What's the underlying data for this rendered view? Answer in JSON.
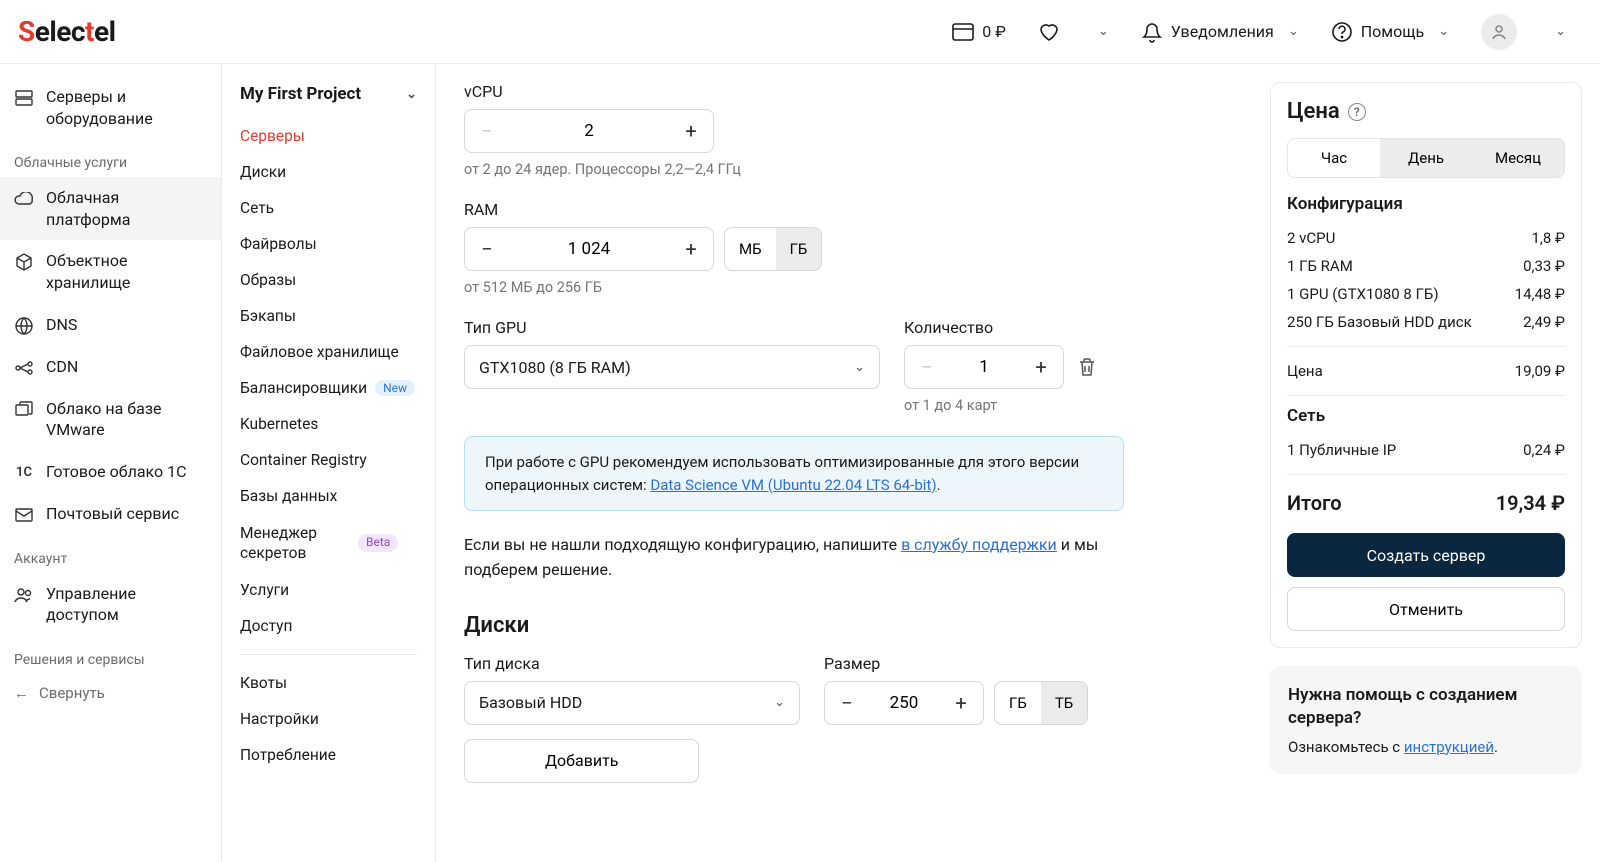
{
  "topbar": {
    "balance": "0 ₽",
    "notifications": "Уведомления",
    "help": "Помощь"
  },
  "sidebar1": {
    "items": [
      {
        "label": "Серверы и оборудование"
      }
    ],
    "section_cloud": "Облачные услуги",
    "cloud_items": [
      {
        "label": "Облачная платформа"
      },
      {
        "label": "Объектное хранилище"
      },
      {
        "label": "DNS"
      },
      {
        "label": "CDN"
      },
      {
        "label": "Облако на базе VMware"
      },
      {
        "label": "Готовое облако 1С"
      },
      {
        "label": "Почтовый сервис"
      }
    ],
    "section_account": "Аккаунт",
    "account_items": [
      {
        "label": "Управление доступом"
      }
    ],
    "section_solutions": "Решения и сервисы",
    "collapse": "Свернуть"
  },
  "sidebar2": {
    "project": "My First Project",
    "items": [
      {
        "label": "Серверы"
      },
      {
        "label": "Диски"
      },
      {
        "label": "Сеть"
      },
      {
        "label": "Файрволы"
      },
      {
        "label": "Образы"
      },
      {
        "label": "Бэкапы"
      },
      {
        "label": "Файловое хранилище"
      },
      {
        "label": "Балансировщики",
        "badge": "New"
      },
      {
        "label": "Kubernetes"
      },
      {
        "label": "Container Registry"
      },
      {
        "label": "Базы данных"
      },
      {
        "label": "Менеджер секретов",
        "badge": "Beta"
      },
      {
        "label": "Услуги"
      },
      {
        "label": "Доступ"
      }
    ],
    "bottom": [
      {
        "label": "Квоты"
      },
      {
        "label": "Настройки"
      },
      {
        "label": "Потребление"
      }
    ]
  },
  "main": {
    "vcpu": {
      "label": "vCPU",
      "value": "2",
      "hint": "от 2 до 24 ядер. Процессоры 2,2—2,4 ГГц"
    },
    "ram": {
      "label": "RAM",
      "value": "1 024",
      "unit_mb": "МБ",
      "unit_gb": "ГБ",
      "hint": "от 512 МБ до 256 ГБ"
    },
    "gpu_type": {
      "label": "Тип GPU",
      "value": "GTX1080 (8 ГБ RAM)"
    },
    "gpu_qty": {
      "label": "Количество",
      "value": "1",
      "hint": "от 1 до 4 карт"
    },
    "info": {
      "text1": "При работе с GPU рекомендуем использовать оптимизированные для этого версии операционных систем: ",
      "link": "Data Science VM (Ubuntu 22.04 LTS 64-bit)"
    },
    "support": {
      "text1": "Если вы не нашли подходящую конфигурацию, напишите ",
      "link": "в службу поддержки",
      "text2": " и мы подберем решение."
    },
    "disks": {
      "heading": "Диски",
      "type_label": "Тип диска",
      "type_value": "Базовый HDD",
      "size_label": "Размер",
      "size_value": "250",
      "unit_gb": "ГБ",
      "unit_tb": "ТБ",
      "add": "Добавить"
    }
  },
  "price": {
    "title": "Цена",
    "tabs": {
      "hour": "Час",
      "day": "День",
      "month": "Месяц"
    },
    "config_h": "Конфигурация",
    "lines": [
      {
        "l": "2 vCPU",
        "r": "1,8 ₽"
      },
      {
        "l": "1 ГБ RAM",
        "r": "0,33 ₽"
      },
      {
        "l": "1 GPU (GTX1080 8 ГБ)",
        "r": "14,48 ₽"
      },
      {
        "l": "250 ГБ Базовый HDD диск",
        "r": "2,49 ₽"
      }
    ],
    "subtotal": {
      "l": "Цена",
      "r": "19,09 ₽"
    },
    "net_h": "Сеть",
    "net": {
      "l": "1 Публичные IP",
      "r": "0,24 ₽"
    },
    "total": {
      "l": "Итого",
      "r": "19,34 ₽"
    },
    "create": "Создать сервер",
    "cancel": "Отменить",
    "help": {
      "title": "Нужна помощь с созданием сервера?",
      "text": "Ознакомьтесь с ",
      "link": "инструкцией"
    }
  }
}
